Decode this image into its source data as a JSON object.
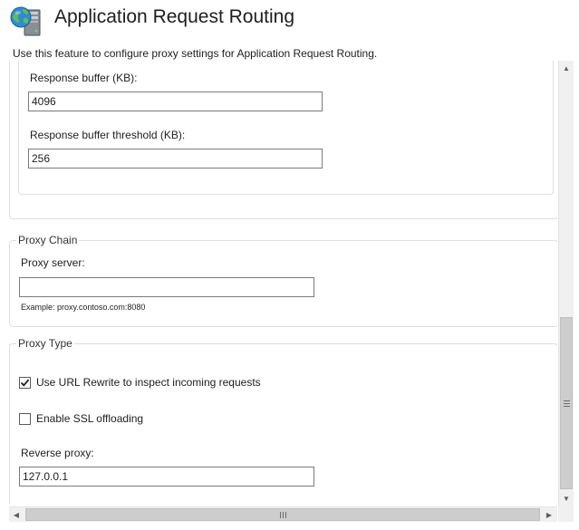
{
  "header": {
    "title": "Application Request Routing",
    "description": "Use this feature to configure proxy settings for Application Request Routing.",
    "icon": "globe-server-icon"
  },
  "buffer_settings": {
    "response_buffer_label": "Response buffer (KB):",
    "response_buffer_value": "4096",
    "response_buffer_threshold_label": "Response buffer threshold (KB):",
    "response_buffer_threshold_value": "256"
  },
  "proxy_chain": {
    "legend": "Proxy Chain",
    "proxy_server_label": "Proxy server:",
    "proxy_server_value": "",
    "example": "Example: proxy.contoso.com:8080"
  },
  "proxy_type": {
    "legend": "Proxy Type",
    "url_rewrite_label": "Use URL Rewrite to inspect incoming requests",
    "url_rewrite_checked": true,
    "ssl_offloading_label": "Enable SSL offloading",
    "ssl_offloading_checked": false,
    "reverse_proxy_label": "Reverse proxy:",
    "reverse_proxy_value": "127.0.0.1"
  },
  "scrollbars": {
    "up_arrow": "▲",
    "down_arrow": "▼",
    "left_arrow": "◀",
    "right_arrow": "▶"
  },
  "colors": {
    "frame_border": "#dedede",
    "input_border": "#7a7a7a",
    "scrollbar_track": "#f0f0f0",
    "scrollbar_thumb": "#cdcdcd"
  }
}
